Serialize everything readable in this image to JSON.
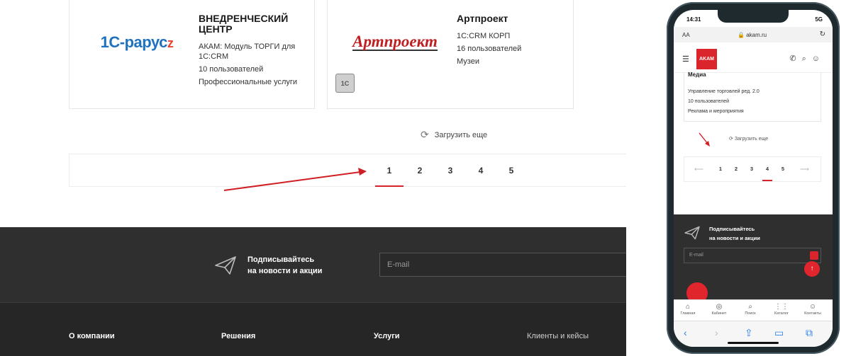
{
  "cards": [
    {
      "logo_text": "1С-рарус",
      "title": "ВНЕДРЕНЧЕСКИЙ ЦЕНТР",
      "product": "АКАМ: Модуль ТОРГИ для 1С:CRM",
      "users": "10 пользователей",
      "industry": "Профессиональные услуги"
    },
    {
      "logo_text": "Артпроект",
      "title": "Артпроект",
      "product": "1С:CRM КОРП",
      "users": "16 пользователей",
      "industry": "Музеи",
      "badge": "1С"
    }
  ],
  "load_more": "Загрузить еще",
  "pagination": {
    "pages": [
      "1",
      "2",
      "3",
      "4",
      "5"
    ],
    "active_page": "1"
  },
  "subscribe": {
    "text_line1": "Подписывайтесь",
    "text_line2": "на новости и акции",
    "email_placeholder": "E-mail"
  },
  "footer": {
    "columns": [
      "О компании",
      "Решения",
      "Услуги",
      "Клиенты и кейсы"
    ]
  },
  "phone": {
    "time": "14:31",
    "network": "5G",
    "aa": "AA",
    "url": "akam.ru",
    "logo": "AKAM",
    "card_title": "Медиа",
    "card_product": "Управление торговлей ред. 2.0",
    "card_users": "10 пользователей",
    "card_industry": "Реклама и мероприятия",
    "load_more": "Загрузить еще",
    "pages": [
      "1",
      "2",
      "3",
      "4",
      "5"
    ],
    "active_page": "4",
    "subscribe_line1": "Подписывайтесь",
    "subscribe_line2": "на новости и акции",
    "email_placeholder": "E-mail",
    "tabs": [
      "Главная",
      "Кабинет",
      "Поиск",
      "Каталог",
      "Контакты"
    ]
  },
  "colors": {
    "accent": "#d6232a",
    "dark_bg": "#2f2f2f",
    "annotation_arrow": "#d01f24"
  }
}
